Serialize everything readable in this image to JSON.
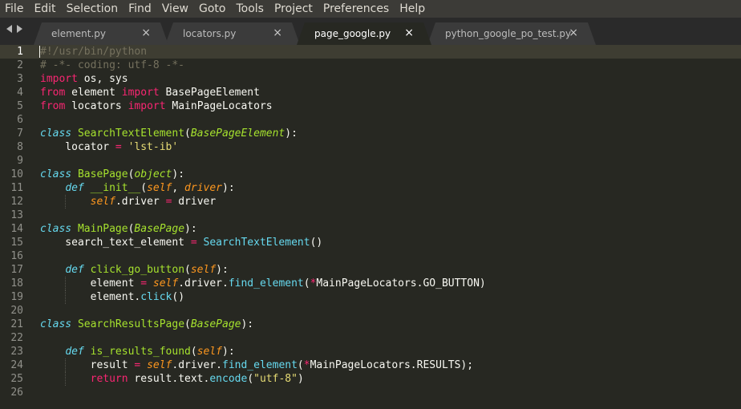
{
  "menu": [
    "File",
    "Edit",
    "Selection",
    "Find",
    "View",
    "Goto",
    "Tools",
    "Project",
    "Preferences",
    "Help"
  ],
  "tabs": [
    {
      "label": "element.py",
      "close": "×",
      "active": false
    },
    {
      "label": "locators.py",
      "close": "×",
      "active": false
    },
    {
      "label": "page_google.py",
      "close": "×",
      "active": true
    },
    {
      "label": "python_google_po_test.py",
      "close": "×",
      "active": false
    }
  ],
  "editor": {
    "current_line": 1,
    "lines": [
      [
        [
          "cmt",
          "#!/usr/bin/python"
        ]
      ],
      [
        [
          "cmt",
          "# -*- coding: utf-8 -*-"
        ]
      ],
      [
        [
          "kw",
          "import"
        ],
        [
          "plain",
          " os, sys"
        ]
      ],
      [
        [
          "kw",
          "from"
        ],
        [
          "plain",
          " element "
        ],
        [
          "kw",
          "import"
        ],
        [
          "plain",
          " BasePageElement"
        ]
      ],
      [
        [
          "kw",
          "from"
        ],
        [
          "plain",
          " locators "
        ],
        [
          "kw",
          "import"
        ],
        [
          "plain",
          " MainPageLocators"
        ]
      ],
      [],
      [
        [
          "kw-b",
          "class"
        ],
        [
          "plain",
          " "
        ],
        [
          "cls",
          "SearchTextElement"
        ],
        [
          "plain",
          "("
        ],
        [
          "inh",
          "BasePageElement"
        ],
        [
          "plain",
          "):"
        ]
      ],
      [
        [
          "plain",
          "    locator "
        ],
        [
          "op",
          "="
        ],
        [
          "plain",
          " "
        ],
        [
          "str",
          "'lst-ib'"
        ]
      ],
      [],
      [
        [
          "kw-b",
          "class"
        ],
        [
          "plain",
          " "
        ],
        [
          "cls",
          "BasePage"
        ],
        [
          "plain",
          "("
        ],
        [
          "inh",
          "object"
        ],
        [
          "plain",
          "):"
        ]
      ],
      [
        [
          "plain",
          "    "
        ],
        [
          "kw-b",
          "def"
        ],
        [
          "plain",
          " "
        ],
        [
          "fn",
          "__init__"
        ],
        [
          "plain",
          "("
        ],
        [
          "param",
          "self"
        ],
        [
          "plain",
          ", "
        ],
        [
          "param",
          "driver"
        ],
        [
          "plain",
          "):"
        ]
      ],
      [
        [
          "plain",
          "        "
        ],
        [
          "self",
          "self"
        ],
        [
          "plain",
          ".driver "
        ],
        [
          "op",
          "="
        ],
        [
          "plain",
          " driver"
        ]
      ],
      [],
      [
        [
          "kw-b",
          "class"
        ],
        [
          "plain",
          " "
        ],
        [
          "cls",
          "MainPage"
        ],
        [
          "plain",
          "("
        ],
        [
          "inh",
          "BasePage"
        ],
        [
          "plain",
          "):"
        ]
      ],
      [
        [
          "plain",
          "    search_text_element "
        ],
        [
          "op",
          "="
        ],
        [
          "plain",
          " "
        ],
        [
          "call",
          "SearchTextElement"
        ],
        [
          "plain",
          "()"
        ]
      ],
      [],
      [
        [
          "plain",
          "    "
        ],
        [
          "kw-b",
          "def"
        ],
        [
          "plain",
          " "
        ],
        [
          "fn",
          "click_go_button"
        ],
        [
          "plain",
          "("
        ],
        [
          "param",
          "self"
        ],
        [
          "plain",
          "):"
        ]
      ],
      [
        [
          "plain",
          "        element "
        ],
        [
          "op",
          "="
        ],
        [
          "plain",
          " "
        ],
        [
          "self",
          "self"
        ],
        [
          "plain",
          ".driver."
        ],
        [
          "call",
          "find_element"
        ],
        [
          "plain",
          "("
        ],
        [
          "op",
          "*"
        ],
        [
          "plain",
          "MainPageLocators.GO_BUTTON)"
        ]
      ],
      [
        [
          "plain",
          "        element."
        ],
        [
          "call",
          "click"
        ],
        [
          "plain",
          "()"
        ]
      ],
      [],
      [
        [
          "kw-b",
          "class"
        ],
        [
          "plain",
          " "
        ],
        [
          "cls",
          "SearchResultsPage"
        ],
        [
          "plain",
          "("
        ],
        [
          "inh",
          "BasePage"
        ],
        [
          "plain",
          "):"
        ]
      ],
      [],
      [
        [
          "plain",
          "    "
        ],
        [
          "kw-b",
          "def"
        ],
        [
          "plain",
          " "
        ],
        [
          "fn",
          "is_results_found"
        ],
        [
          "plain",
          "("
        ],
        [
          "param",
          "self"
        ],
        [
          "plain",
          "):"
        ]
      ],
      [
        [
          "plain",
          "        result "
        ],
        [
          "op",
          "="
        ],
        [
          "plain",
          " "
        ],
        [
          "self",
          "self"
        ],
        [
          "plain",
          ".driver."
        ],
        [
          "call",
          "find_element"
        ],
        [
          "plain",
          "("
        ],
        [
          "op",
          "*"
        ],
        [
          "plain",
          "MainPageLocators.RESULTS);"
        ]
      ],
      [
        [
          "plain",
          "        "
        ],
        [
          "kw",
          "return"
        ],
        [
          "plain",
          " result.text."
        ],
        [
          "call",
          "encode"
        ],
        [
          "plain",
          "("
        ],
        [
          "str",
          "\"utf-8\""
        ],
        [
          "plain",
          ")"
        ]
      ],
      []
    ]
  },
  "colors": {
    "background": "#272822",
    "menubar": "#3c3b37",
    "tab_inactive": "#3b3b3b",
    "keyword": "#f92672",
    "storage": "#66d9ef",
    "class_name": "#a6e22e",
    "string": "#e6db74",
    "comment": "#75715e",
    "param": "#fd971f"
  }
}
